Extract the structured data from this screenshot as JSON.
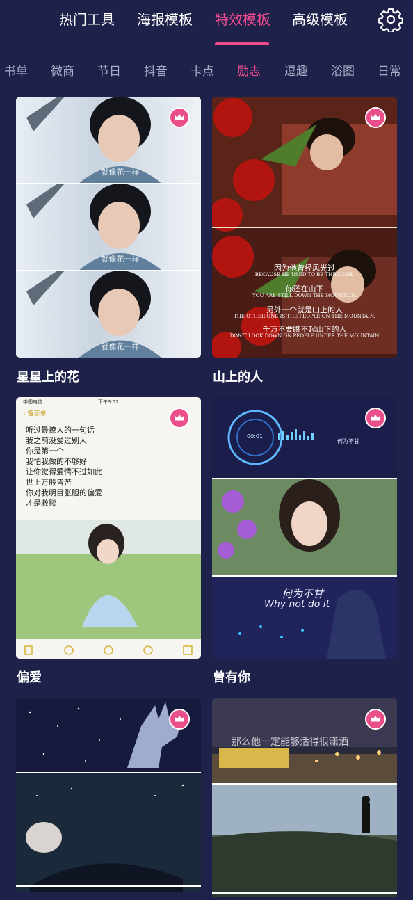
{
  "tabs": [
    {
      "label": "热门工具",
      "active": false
    },
    {
      "label": "海报模板",
      "active": false
    },
    {
      "label": "特效模板",
      "active": true
    },
    {
      "label": "高级模板",
      "active": false
    }
  ],
  "settings_icon": "gear-icon",
  "categories": [
    {
      "label": "书单",
      "active": false
    },
    {
      "label": "微商",
      "active": false
    },
    {
      "label": "节日",
      "active": false
    },
    {
      "label": "抖音",
      "active": false
    },
    {
      "label": "卡点",
      "active": false
    },
    {
      "label": "励志",
      "active": true
    },
    {
      "label": "逗趣",
      "active": false
    },
    {
      "label": "浴图",
      "active": false
    },
    {
      "label": "日常",
      "active": false
    }
  ],
  "templates": [
    {
      "title": "星星上的花",
      "badge": "crown-icon",
      "overlay": [
        "就像花一样",
        "就像花一样",
        "就像花一样"
      ]
    },
    {
      "title": "山上的人",
      "badge": "crown-icon",
      "overlay": [
        "因为他曾经风光过",
        "BECAUSE HE USED TO BE THROUGH.",
        "你还在山下",
        "YOU ARE STILL DOWN THE MOUNTAIN.",
        "另外一个就是山上的人",
        "THE OTHER ONE IS THE PEOPLE ON THE MOUNTAIN.",
        "千万不要瞧不起山下的人",
        "DON'T LOOK DOWN ON PEOPLE UNDER THE MOUNTAIN"
      ]
    },
    {
      "title": "偏爱",
      "badge": "crown-icon",
      "status": {
        "carrier": "中国电信",
        "time": "下午3:52"
      },
      "back": "备忘录",
      "note_lines": [
        "听过最撩人的一句话",
        "我之前没爱过别人",
        "你是第一个",
        "我怕我做的不够好",
        "让你觉得爱情不过如此",
        "世上万般皆苦",
        "你对我明目张胆的偏爱",
        "才是救赎"
      ]
    },
    {
      "title": "曾有你",
      "badge": "crown-icon",
      "player_time": "00:01",
      "small_caption": "何为不甘",
      "caption_cn": "何为不甘",
      "caption_en": "Why not do it"
    },
    {
      "title": "",
      "badge": "crown-icon"
    },
    {
      "title": "",
      "badge": "crown-icon",
      "caption": "那么他一定能够活得很潇洒"
    }
  ]
}
